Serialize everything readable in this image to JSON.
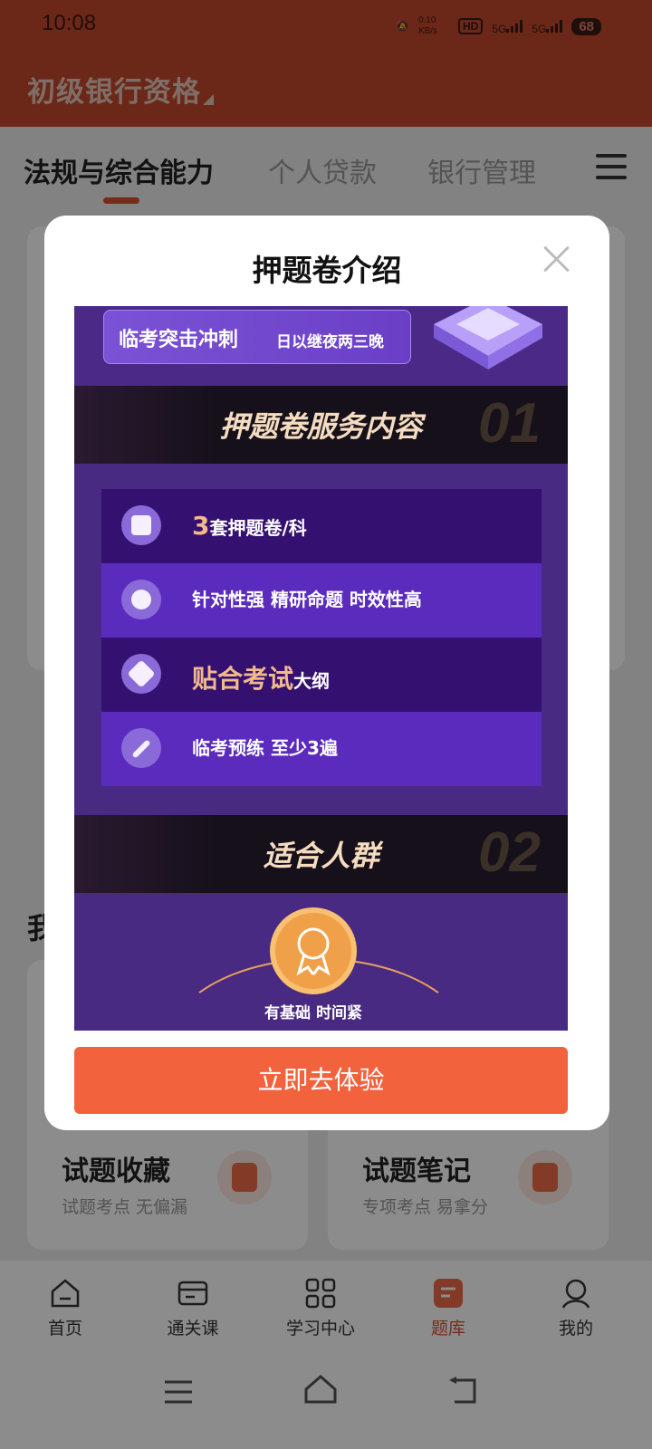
{
  "status": {
    "time": "10:08",
    "net_speed": "0.10 KB/s",
    "hd": "HD",
    "sig1": "5G",
    "sig2": "5G",
    "battery": "68"
  },
  "header": {
    "title": "初级银行资格"
  },
  "tabs": [
    {
      "label": "法规与综合能力",
      "active": true
    },
    {
      "label": "个人贷款",
      "active": false
    },
    {
      "label": "银行管理",
      "active": false
    }
  ],
  "background": {
    "section_label": "我",
    "cards": [
      {
        "title": "试题收藏",
        "subtitle": "试题考点 无偏漏"
      },
      {
        "title": "试题笔记",
        "subtitle": "专项考点 易拿分"
      }
    ]
  },
  "bottom_nav": [
    {
      "label": "首页",
      "icon": "home-icon"
    },
    {
      "label": "通关课",
      "icon": "card-icon"
    },
    {
      "label": "学习中心",
      "icon": "grid-icon"
    },
    {
      "label": "题库",
      "icon": "question-bank-icon",
      "active": true
    },
    {
      "label": "我的",
      "icon": "person-icon"
    }
  ],
  "dialog": {
    "title": "押题卷介绍",
    "promo": {
      "banner_main": "临考突击冲刺",
      "banner_minor": "日以继夜两三晚",
      "section1_title": "押题卷服务内容",
      "section1_num": "01",
      "rows": [
        {
          "lead": "3",
          "text": "套押题卷/科"
        },
        {
          "lead": "",
          "text": "针对性强  精研命题  时效性高"
        },
        {
          "lead": "贴合考试",
          "text": "大纲"
        },
        {
          "lead": "",
          "text": "临考预练  至少3遍"
        }
      ],
      "section2_title": "适合人群",
      "section2_num": "02",
      "medal_label": "有基础 时间紧"
    },
    "cta": "立即去体验"
  }
}
